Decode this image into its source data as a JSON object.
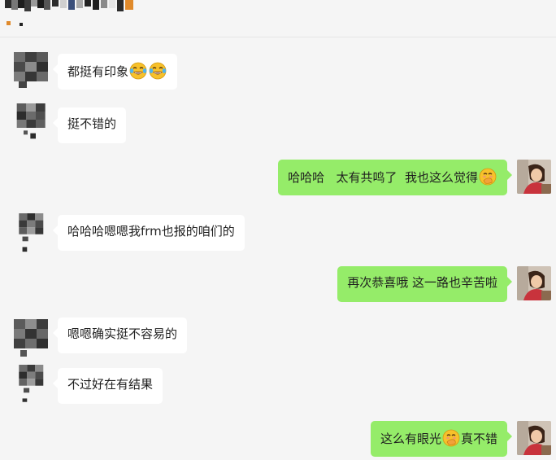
{
  "colors": {
    "background": "#f5f5f5",
    "incoming_bubble": "#ffffff",
    "outgoing_bubble": "#95ec69"
  },
  "messages": [
    {
      "direction": "in",
      "parts": [
        {
          "text": "都挺有印象"
        },
        {
          "emoji": "tears-of-joy"
        },
        {
          "emoji": "tears-of-joy"
        }
      ]
    },
    {
      "direction": "in",
      "parts": [
        {
          "text": "挺不错的"
        }
      ]
    },
    {
      "direction": "out",
      "parts": [
        {
          "text": "哈哈哈   太有共鸣了  我也这么觉得"
        },
        {
          "emoji": "hand-over-mouth"
        }
      ]
    },
    {
      "direction": "in",
      "parts": [
        {
          "text": "哈哈哈嗯嗯我frm也报的咱们的"
        }
      ]
    },
    {
      "direction": "out",
      "parts": [
        {
          "text": "再次恭喜哦 这一路也辛苦啦"
        }
      ]
    },
    {
      "direction": "in",
      "parts": [
        {
          "text": "嗯嗯确实挺不容易的"
        }
      ]
    },
    {
      "direction": "in",
      "parts": [
        {
          "text": "不过好在有结果"
        }
      ]
    },
    {
      "direction": "out",
      "parts": [
        {
          "text": "这么有眼光"
        },
        {
          "emoji": "hand-over-mouth"
        },
        {
          "text": "真不错"
        }
      ]
    }
  ]
}
